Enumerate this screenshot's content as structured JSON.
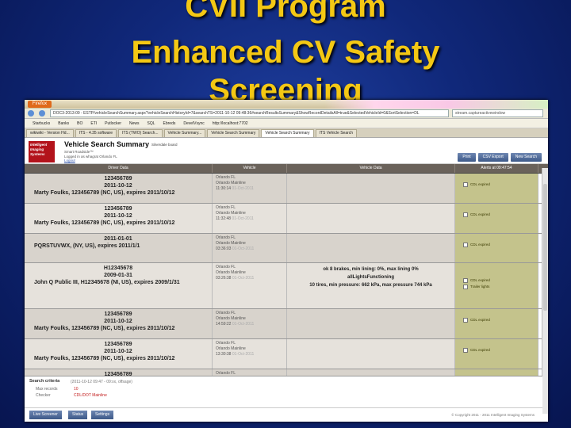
{
  "slide": {
    "title_line1": "CVII Program",
    "title_line2": "Enhanced CV Safety",
    "title_line3": "Screening"
  },
  "browser": {
    "app_button": "Firefox",
    "url": "DOC3-2013:09 - ESTP/vehicleSearchSummary.aspx?vehicleSearchHistoryId=7&searchTS=2011-10-12 09:48:36#searchResultsSummary&ShowRecordDetailsAll=true&SelectedVehicleId=0&SortSelection=DL",
    "search_placeholder": "stream.captureactivewindow",
    "bookmarks": [
      "Starbucks",
      "Banks",
      "BO",
      "ETI",
      "Putlocker",
      "News",
      "SQL",
      "Ebreds",
      "DevelVsync",
      "http://localhost:7702"
    ],
    "tabs": [
      "wikiwiki - Version Hd...",
      "ITS - 4.35 software",
      "ITS (TWO) Search...",
      "Vehicle Summary...",
      "Vehicle Search Summary",
      "Vehicle Search Summary",
      "ITS Vehicle Search"
    ]
  },
  "app": {
    "logo_text": "Intelligent Imaging Systems",
    "page_title": "Vehicle Search Summary",
    "page_subtitle": "Silverdale board",
    "product": "Smart Roadside™",
    "logged_in": "Logged in as whagrat Orlando FL",
    "logout": "Logout",
    "buttons": {
      "print": "Print",
      "csv": "CSV Export",
      "new_search": "New Search"
    },
    "columns": {
      "driver": "Driver Data",
      "vehicle": "Vehicle",
      "vehicle_data": "Vehicle Data",
      "alerts": "Alerts at 09:47:54"
    }
  },
  "rows": [
    {
      "id": "123456789",
      "date": "2011-10-12",
      "name": "Marty Foulks, 123456789 (NC, US), expires 2011/10/12",
      "loc": "Orlando FL",
      "site": "Orlando Mainline",
      "time": "11:30:14",
      "time_note": "01-Oct-2011",
      "vd": [],
      "alerts": [
        "CDL expired"
      ]
    },
    {
      "id": "123456789",
      "date": "2011-10-12",
      "name": "Marty Foulks, 123456789 (NC, US), expires 2011/10/12",
      "loc": "Orlando FL",
      "site": "Orlando Mainline",
      "time": "11:32:48",
      "time_note": "01-Oct-2011",
      "vd": [],
      "alerts": [
        "CDL expired"
      ]
    },
    {
      "id": "",
      "date": "2011-01-01",
      "name": "PQRSTUVWX, (NY, US), expires 2011/1/1",
      "loc": "Orlando FL",
      "site": "Orlando Mainline",
      "time": "03:36:03",
      "time_note": "01-Oct-2011",
      "vd": [],
      "alerts": [
        "CDL expired"
      ]
    },
    {
      "id": "H12345678",
      "date": "2009-01-31",
      "name": "John Q Public III, H12345678 (NI, US), expires 2009/1/31",
      "loc": "Orlando FL",
      "site": "Orlando Mainline",
      "time": "03:26:38",
      "time_note": "01-Oct-2011",
      "vd": [
        "ok 8 brakes, min lining: 0%, max lining 0%",
        "allLightsFunctioning",
        "10 tires, min pressure: 662 kPa, max pressure 744 kPa"
      ],
      "alerts": [
        "CDL expired",
        "Trailer lights"
      ]
    },
    {
      "id": "123456789",
      "date": "2011-10-12",
      "name": "Marty Foulks, 123456789 (NC, US), expires 2011/10/12",
      "loc": "Orlando FL",
      "site": "Orlando Mainline",
      "time": "14:59:22",
      "time_note": "01-Oct-2011",
      "vd": [],
      "alerts": [
        "CDL expired"
      ]
    },
    {
      "id": "123456789",
      "date": "2011-10-12",
      "name": "Marty Foulks, 123456789 (NC, US), expires 2011/10/12",
      "loc": "Orlando FL",
      "site": "Orlando Mainline",
      "time": "13:30:38",
      "time_note": "01-Oct-2011",
      "vd": [],
      "alerts": [
        "CDL expired"
      ]
    },
    {
      "id": "123456789",
      "date": "2011-10-12",
      "name": "",
      "loc": "Orlando FL",
      "site": "Orlando Mainline",
      "time": "",
      "time_note": "",
      "vd": [],
      "alerts": [
        "CDL expired"
      ]
    }
  ],
  "criteria": {
    "label": "Search criteria",
    "value": "(2011-10-12 09:47 - 09:xx, offsage)",
    "max_records_label": "Max records",
    "max_records": "10",
    "checker_label": "Checker",
    "checker_value": "CDL/DOT Mainline"
  },
  "footer": {
    "buttons": [
      "Live Screener",
      "Status",
      "Settings"
    ],
    "copyright": "© Copyright 2011 - 2011 Intelligent Imaging Systems"
  }
}
